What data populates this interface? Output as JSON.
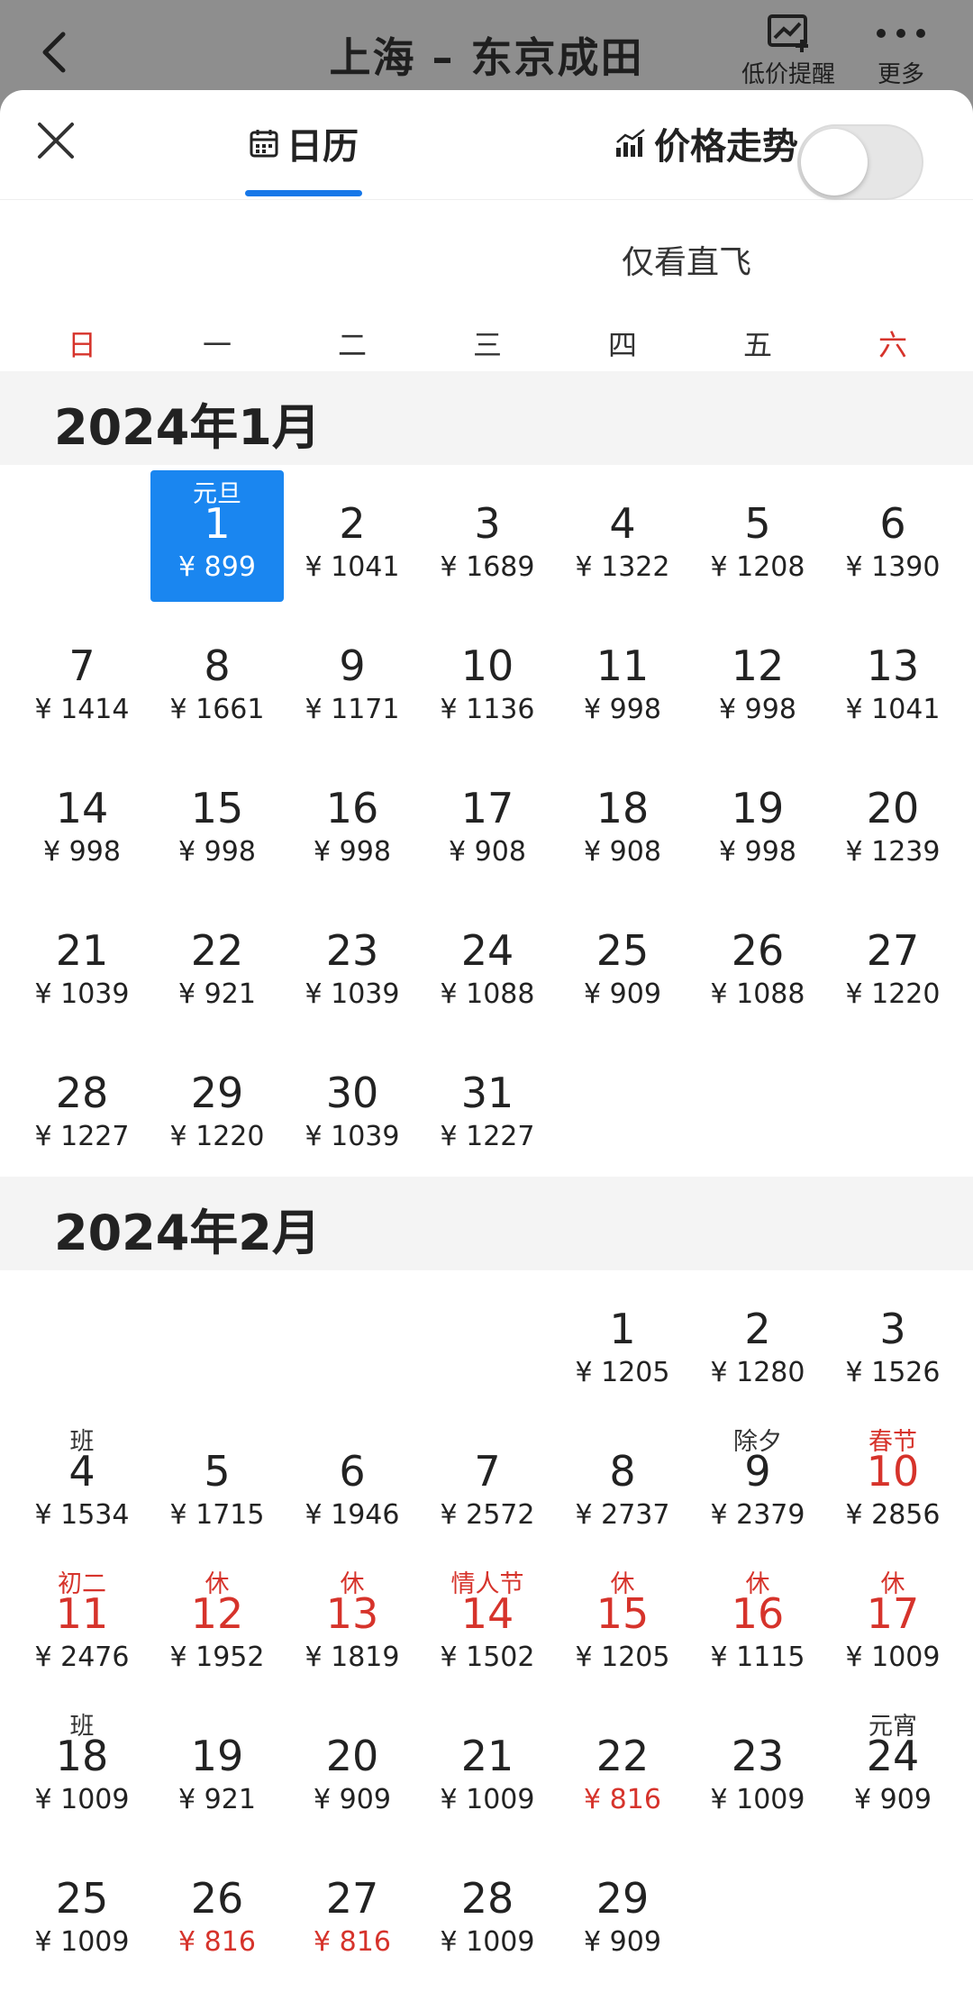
{
  "header": {
    "title": "上海 – 东京成田",
    "low_price_alert": "低价提醒",
    "more": "更多"
  },
  "tabs": {
    "calendar": "日历",
    "trend": "价格走势"
  },
  "filter": {
    "direct_only": "仅看直飞",
    "direct_only_on": false
  },
  "weekdays": [
    "日",
    "一",
    "二",
    "三",
    "四",
    "五",
    "六"
  ],
  "colors": {
    "accent": "#1677e8",
    "holiday_red": "#d6332b",
    "selected_bg": "#1a86f0"
  },
  "months": [
    {
      "title": "2024年1月",
      "days": [
        {
          "day": "1",
          "price": "¥ 899",
          "tag": "元旦",
          "selected": true
        },
        {
          "day": "2",
          "price": "¥ 1041"
        },
        {
          "day": "3",
          "price": "¥ 1689"
        },
        {
          "day": "4",
          "price": "¥ 1322"
        },
        {
          "day": "5",
          "price": "¥ 1208"
        },
        {
          "day": "6",
          "price": "¥ 1390"
        },
        {
          "day": "7",
          "price": "¥ 1414"
        },
        {
          "day": "8",
          "price": "¥ 1661"
        },
        {
          "day": "9",
          "price": "¥ 1171"
        },
        {
          "day": "10",
          "price": "¥ 1136"
        },
        {
          "day": "11",
          "price": "¥ 998"
        },
        {
          "day": "12",
          "price": "¥ 998"
        },
        {
          "day": "13",
          "price": "¥ 1041"
        },
        {
          "day": "14",
          "price": "¥ 998"
        },
        {
          "day": "15",
          "price": "¥ 998"
        },
        {
          "day": "16",
          "price": "¥ 998"
        },
        {
          "day": "17",
          "price": "¥ 908"
        },
        {
          "day": "18",
          "price": "¥ 908"
        },
        {
          "day": "19",
          "price": "¥ 998"
        },
        {
          "day": "20",
          "price": "¥ 1239"
        },
        {
          "day": "21",
          "price": "¥ 1039"
        },
        {
          "day": "22",
          "price": "¥ 921"
        },
        {
          "day": "23",
          "price": "¥ 1039"
        },
        {
          "day": "24",
          "price": "¥ 1088"
        },
        {
          "day": "25",
          "price": "¥ 909"
        },
        {
          "day": "26",
          "price": "¥ 1088"
        },
        {
          "day": "27",
          "price": "¥ 1220"
        },
        {
          "day": "28",
          "price": "¥ 1227"
        },
        {
          "day": "29",
          "price": "¥ 1220"
        },
        {
          "day": "30",
          "price": "¥ 1039"
        },
        {
          "day": "31",
          "price": "¥ 1227"
        }
      ]
    },
    {
      "title": "2024年2月",
      "days": [
        {
          "day": "1",
          "price": "¥ 1205"
        },
        {
          "day": "2",
          "price": "¥ 1280"
        },
        {
          "day": "3",
          "price": "¥ 1526"
        },
        {
          "day": "4",
          "price": "¥ 1534",
          "tag": "班"
        },
        {
          "day": "5",
          "price": "¥ 1715"
        },
        {
          "day": "6",
          "price": "¥ 1946"
        },
        {
          "day": "7",
          "price": "¥ 2572"
        },
        {
          "day": "8",
          "price": "¥ 2737"
        },
        {
          "day": "9",
          "price": "¥ 2379",
          "tag": "除夕"
        },
        {
          "day": "10",
          "price": "¥ 2856",
          "tag": "春节",
          "holiday": true
        },
        {
          "day": "11",
          "price": "¥ 2476",
          "tag": "初二",
          "holiday": true
        },
        {
          "day": "12",
          "price": "¥ 1952",
          "tag": "休",
          "holiday": true
        },
        {
          "day": "13",
          "price": "¥ 1819",
          "tag": "休",
          "holiday": true
        },
        {
          "day": "14",
          "price": "¥ 1502",
          "tag": "情人节",
          "holiday": true
        },
        {
          "day": "15",
          "price": "¥ 1205",
          "tag": "休",
          "holiday": true
        },
        {
          "day": "16",
          "price": "¥ 1115",
          "tag": "休",
          "holiday": true
        },
        {
          "day": "17",
          "price": "¥ 1009",
          "tag": "休",
          "holiday": true
        },
        {
          "day": "18",
          "price": "¥ 1009",
          "tag": "班"
        },
        {
          "day": "19",
          "price": "¥ 921"
        },
        {
          "day": "20",
          "price": "¥ 909"
        },
        {
          "day": "21",
          "price": "¥ 1009"
        },
        {
          "day": "22",
          "price": "¥ 816",
          "low": true
        },
        {
          "day": "23",
          "price": "¥ 1009"
        },
        {
          "day": "24",
          "price": "¥ 909",
          "tag": "元宵"
        },
        {
          "day": "25",
          "price": "¥ 1009"
        },
        {
          "day": "26",
          "price": "¥ 816",
          "low": true
        },
        {
          "day": "27",
          "price": "¥ 816",
          "low": true
        },
        {
          "day": "28",
          "price": "¥ 1009"
        },
        {
          "day": "29",
          "price": "¥ 909"
        }
      ]
    }
  ]
}
